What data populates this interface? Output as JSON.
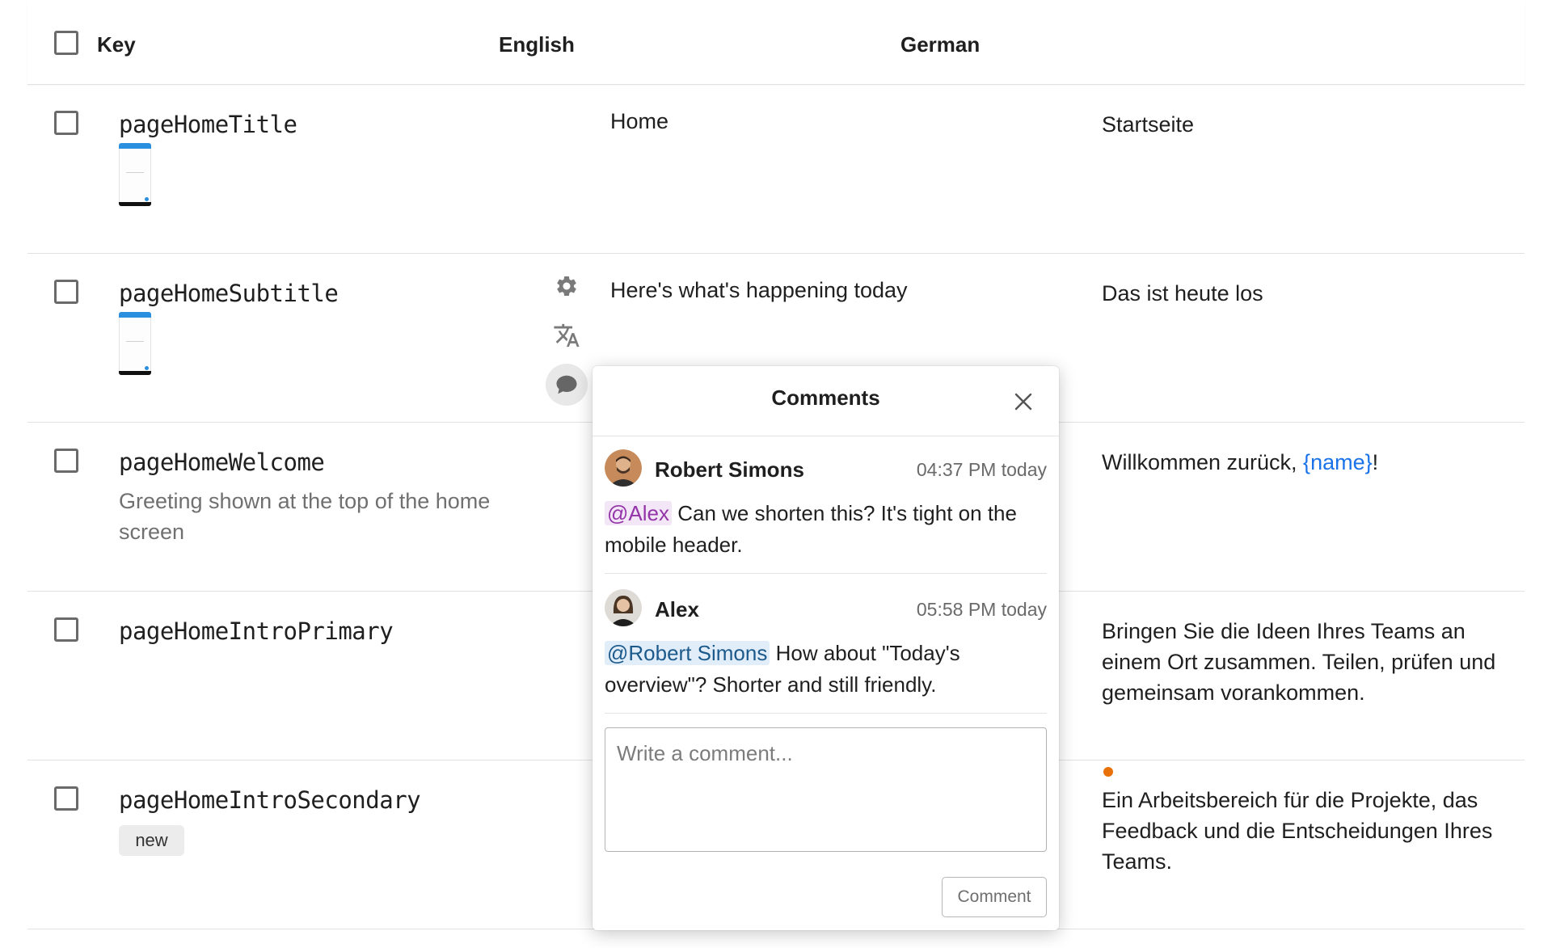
{
  "header": {
    "key": "Key",
    "english": "English",
    "german": "German"
  },
  "rows": [
    {
      "key": "pageHomeTitle",
      "en": "Home",
      "de": "Startseite"
    },
    {
      "key": "pageHomeSubtitle",
      "en": "Here's what's happening today",
      "de": "Das ist heute los"
    },
    {
      "key": "pageHomeWelcome",
      "description": "Greeting shown at the top of the home screen",
      "en": "",
      "de_prefix": "Willkommen zurück, ",
      "de_open": "{",
      "de_placeholder": "name",
      "de_close": "}",
      "de_suffix": "!"
    },
    {
      "key": "pageHomeIntroPrimary",
      "en": "",
      "de": "Bringen Sie die Ideen Ihres Teams an einem Ort zusammen. Teilen, prüfen und gemeinsam vorankommen."
    },
    {
      "key": "pageHomeIntroSecondary",
      "badge": "new",
      "en": "",
      "de": "Ein Arbeitsbereich für die Projekte, das Feedback und die Entscheidungen Ihres Teams."
    }
  ],
  "icons": {
    "settings": "gear-icon",
    "translate": "translate-icon",
    "comment": "comment-bubble-icon",
    "close": "close-icon",
    "unsaved": "orange-dot"
  },
  "colors": {
    "placeholder_text": "#1a73e8",
    "mention_1_bg": "#f3e6f7",
    "mention_1_text": "#9334a8",
    "mention_2_bg": "#e1eef9",
    "mention_2_text": "#1d5a8c",
    "unsaved_dot": "#e8710a"
  },
  "comments_popup": {
    "title": "Comments",
    "comments": [
      {
        "author": "Robert Simons",
        "time": "04:37 PM today",
        "mention": "@Alex",
        "text": " Can we shorten this? It's tight on the mobile header."
      },
      {
        "author": "Alex",
        "time": "05:58 PM today",
        "mention": "@Robert Simons",
        "text": " How about \"Today's overview\"? Shorter and still friendly."
      }
    ],
    "input_placeholder": "Write a comment...",
    "submit_label": "Comment"
  }
}
